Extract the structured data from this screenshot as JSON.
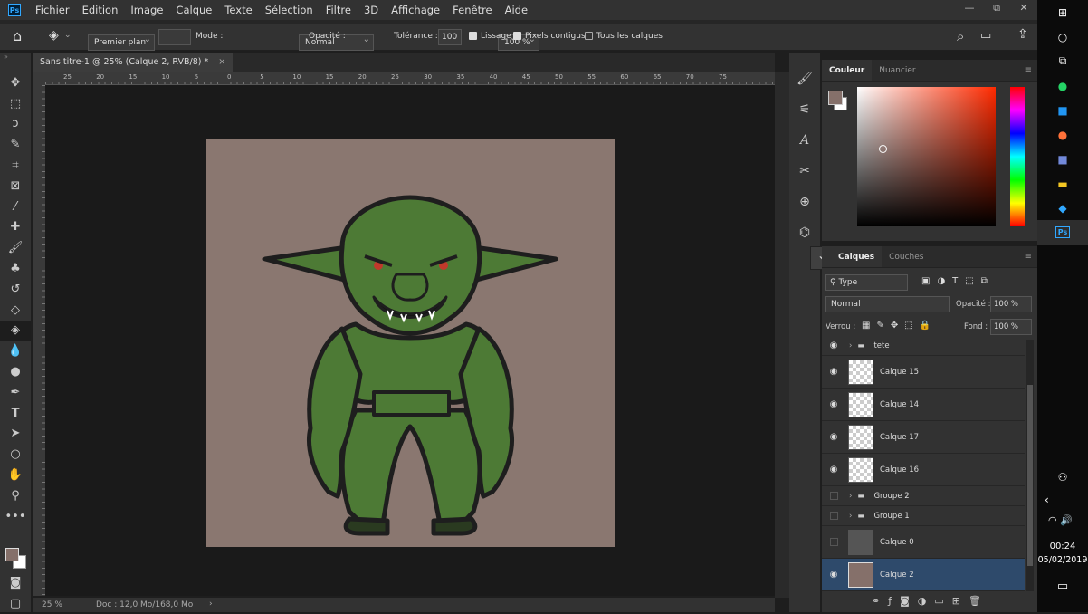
{
  "app": {
    "logo": "Ps"
  },
  "menu": [
    "Fichier",
    "Edition",
    "Image",
    "Calque",
    "Texte",
    "Sélection",
    "Filtre",
    "3D",
    "Affichage",
    "Fenêtre",
    "Aide"
  ],
  "window_controls": [
    "—",
    "⧉",
    "✕"
  ],
  "options": {
    "fill_source": "Premier plan",
    "mode_label": "Mode :",
    "mode_value": "Normal",
    "opacity_label": "Opacité :",
    "opacity_value": "100 %",
    "tolerance_label": "Tolérance :",
    "tolerance_value": "100",
    "lissage": "Lissage",
    "pixels_contigus": "Pixels contigus",
    "tous_calques": "Tous les calques"
  },
  "document": {
    "tab_title": "Sans titre-1 @ 25% (Calque 2, RVB/8) *",
    "close": "×",
    "zoom": "25 %",
    "doc_info": "Doc : 12,0 Mo/168,0 Mo"
  },
  "ruler_h": [
    "25",
    "20",
    "15",
    "10",
    "5",
    "0",
    "5",
    "10",
    "15",
    "20",
    "25",
    "30",
    "35",
    "40",
    "45",
    "50",
    "55",
    "60",
    "65",
    "70",
    "75"
  ],
  "color_panel": {
    "tabs": [
      "Couleur",
      "Nuancier"
    ],
    "foreground": "#85706a",
    "background": "#ffffff",
    "accent": "#31a8ff"
  },
  "layers_panel": {
    "tabs": [
      "Calques",
      "Couches"
    ],
    "filter": "Type",
    "blend_mode": "Normal",
    "opacity_label": "Opacité :",
    "opacity_value": "100 %",
    "lock_label": "Verrou :",
    "fill_label": "Fond :",
    "fill_value": "100 %",
    "layers": [
      {
        "name": "tete",
        "type": "group",
        "visible": true
      },
      {
        "name": "Calque 15",
        "type": "layer",
        "visible": true
      },
      {
        "name": "Calque 14",
        "type": "layer",
        "visible": true
      },
      {
        "name": "Calque 17",
        "type": "layer",
        "visible": true
      },
      {
        "name": "Calque 16",
        "type": "layer",
        "visible": true
      },
      {
        "name": "Groupe 2",
        "type": "group",
        "visible": false
      },
      {
        "name": "Groupe 1",
        "type": "group",
        "visible": false
      },
      {
        "name": "Calque 0",
        "type": "layer",
        "visible": false
      },
      {
        "name": "Calque 2",
        "type": "layer",
        "visible": true,
        "selected": true
      }
    ]
  },
  "taskbar": {
    "time": "00:24",
    "date": "05/02/2019"
  }
}
